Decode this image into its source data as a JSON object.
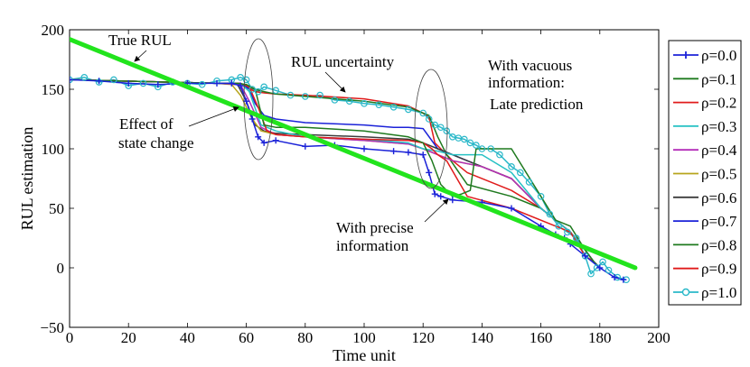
{
  "chart_data": {
    "type": "line",
    "title": "",
    "xlabel": "Time unit",
    "ylabel": "RUL estimation",
    "xlim": [
      0,
      200
    ],
    "ylim": [
      -50,
      200
    ],
    "xticks": [
      "0",
      "20",
      "40",
      "60",
      "80",
      "100",
      "120",
      "140",
      "160",
      "180",
      "200"
    ],
    "yticks": [
      "200",
      "150",
      "100",
      "50",
      "0",
      "−50"
    ],
    "grid": false,
    "legend_position": "right",
    "colors": {
      "true_rul": "#22e41d",
      "rho_0.0": "#1b22d8",
      "rho_0.1": "#1f7a1f",
      "rho_0.2": "#e01b1b",
      "rho_0.3": "#26c1c4",
      "rho_0.4": "#b32cb8",
      "rho_0.5": "#b7a51c",
      "rho_0.6": "#3d3d3d",
      "rho_0.7": "#1b22d8",
      "rho_0.8": "#1f7a1f",
      "rho_0.9": "#e01b1b",
      "rho_1.0": "#2ab8c9"
    },
    "true_rul": {
      "x": [
        0,
        192
      ],
      "y": [
        192,
        0
      ]
    },
    "legend": [
      "ρ=0.0",
      "ρ=0.1",
      "ρ=0.2",
      "ρ=0.3",
      "ρ=0.4",
      "ρ=0.5",
      "ρ=0.6",
      "ρ=0.7",
      "ρ=0.8",
      "ρ=0.9",
      "ρ=1.0"
    ],
    "series": [
      {
        "name": "ρ=0.0",
        "x": [
          0,
          10,
          20,
          30,
          40,
          50,
          55,
          58,
          60,
          62,
          64,
          66,
          70,
          80,
          90,
          100,
          110,
          115,
          120,
          122,
          124,
          126,
          130,
          140,
          150,
          160,
          165,
          168,
          170,
          175,
          180,
          185,
          188
        ],
        "y": [
          158,
          157,
          155,
          154,
          155,
          155,
          155,
          153,
          140,
          125,
          110,
          105,
          107,
          102,
          103,
          100,
          98,
          97,
          95,
          80,
          62,
          60,
          57,
          55,
          50,
          35,
          28,
          25,
          20,
          10,
          0,
          -8,
          -10
        ]
      },
      {
        "name": "ρ=0.1",
        "x": [
          0,
          50,
          57,
          60,
          63,
          66,
          70,
          80,
          100,
          115,
          120,
          123,
          126,
          128,
          130,
          133,
          136,
          138,
          140,
          150,
          160,
          165,
          170,
          175,
          178,
          180
        ],
        "y": [
          158,
          155,
          155,
          154,
          150,
          120,
          118,
          118,
          115,
          110,
          105,
          90,
          70,
          65,
          60,
          62,
          65,
          100,
          100,
          100,
          60,
          40,
          35,
          15,
          5,
          0
        ]
      },
      {
        "name": "ρ=0.2",
        "x": [
          0,
          50,
          58,
          61,
          64,
          67,
          70,
          80,
          100,
          115,
          120,
          123,
          125,
          128,
          135,
          150,
          165,
          170,
          175,
          178,
          180
        ],
        "y": [
          158,
          155,
          155,
          152,
          135,
          115,
          112,
          110,
          108,
          107,
          105,
          100,
          95,
          90,
          60,
          50,
          35,
          30,
          10,
          5,
          0
        ]
      },
      {
        "name": "ρ=0.3",
        "x": [
          0,
          50,
          58,
          61,
          65,
          70,
          80,
          100,
          115,
          120,
          125,
          130,
          140,
          150,
          160,
          165,
          170,
          175,
          178,
          180
        ],
        "y": [
          158,
          155,
          155,
          148,
          120,
          115,
          110,
          108,
          105,
          100,
          98,
          95,
          95,
          80,
          50,
          40,
          30,
          15,
          5,
          0
        ]
      },
      {
        "name": "ρ=0.4",
        "x": [
          0,
          50,
          58,
          61,
          65,
          70,
          80,
          100,
          115,
          120,
          125,
          130,
          140,
          150,
          160,
          165,
          170,
          175,
          178,
          180
        ],
        "y": [
          158,
          155,
          154,
          140,
          118,
          112,
          110,
          107,
          104,
          100,
          95,
          90,
          85,
          75,
          50,
          40,
          30,
          15,
          5,
          0
        ]
      },
      {
        "name": "ρ=0.5",
        "x": [
          0,
          50,
          55,
          58,
          62,
          65,
          70,
          80,
          100,
          115,
          120,
          125,
          130,
          140,
          150,
          160,
          165,
          170,
          175,
          178,
          180
        ],
        "y": [
          158,
          155,
          154,
          145,
          125,
          115,
          112,
          110,
          107,
          104,
          100,
          95,
          90,
          85,
          75,
          50,
          40,
          30,
          15,
          5,
          0
        ]
      },
      {
        "name": "ρ=0.6",
        "x": [
          0,
          50,
          57,
          60,
          63,
          66,
          70,
          80,
          100,
          115,
          120,
          125,
          130,
          140,
          150,
          160,
          165,
          170,
          175,
          178,
          180
        ],
        "y": [
          158,
          155,
          154,
          140,
          120,
          115,
          113,
          112,
          110,
          108,
          105,
          100,
          95,
          85,
          75,
          50,
          40,
          30,
          15,
          5,
          0
        ]
      },
      {
        "name": "ρ=0.7",
        "x": [
          0,
          50,
          58,
          61,
          63,
          66,
          70,
          80,
          100,
          110,
          115,
          120,
          125,
          130,
          140,
          150,
          160,
          165,
          170,
          175,
          178,
          180
        ],
        "y": [
          158,
          155,
          155,
          150,
          138,
          128,
          125,
          122,
          120,
          118,
          118,
          117,
          100,
          95,
          85,
          75,
          50,
          40,
          30,
          15,
          5,
          0
        ]
      },
      {
        "name": "ρ=0.8",
        "x": [
          0,
          50,
          57,
          60,
          63,
          66,
          70,
          80,
          100,
          115,
          120,
          122,
          125,
          128,
          135,
          150,
          160,
          165,
          170,
          175,
          178,
          180
        ],
        "y": [
          158,
          155,
          155,
          153,
          150,
          148,
          146,
          144,
          140,
          135,
          130,
          128,
          110,
          95,
          70,
          60,
          50,
          40,
          30,
          15,
          5,
          0
        ]
      },
      {
        "name": "ρ=0.9",
        "x": [
          0,
          50,
          58,
          60,
          63,
          66,
          70,
          80,
          100,
          115,
          120,
          122,
          124,
          126,
          130,
          135,
          150,
          160,
          165,
          170,
          175,
          178,
          180
        ],
        "y": [
          158,
          155,
          155,
          152,
          148,
          147,
          146,
          145,
          142,
          136,
          130,
          127,
          105,
          100,
          90,
          80,
          65,
          50,
          40,
          30,
          15,
          5,
          0
        ]
      },
      {
        "name": "ρ=1.0",
        "x": [
          0,
          5,
          10,
          15,
          20,
          25,
          30,
          35,
          40,
          45,
          50,
          55,
          58,
          60,
          62,
          64,
          66,
          70,
          75,
          80,
          85,
          90,
          95,
          100,
          105,
          110,
          115,
          120,
          122,
          124,
          126,
          128,
          130,
          132,
          134,
          136,
          138,
          140,
          143,
          146,
          150,
          153,
          156,
          160,
          163,
          166,
          169,
          172,
          175,
          177,
          179,
          181,
          183,
          186,
          189
        ],
        "y": [
          158,
          160,
          156,
          158,
          153,
          155,
          152,
          156,
          155,
          154,
          157,
          158,
          160,
          158,
          150,
          148,
          152,
          149,
          145,
          144,
          145,
          141,
          140,
          138,
          137,
          135,
          133,
          130,
          125,
          120,
          118,
          115,
          110,
          109,
          108,
          105,
          103,
          100,
          100,
          95,
          85,
          80,
          72,
          60,
          45,
          35,
          30,
          25,
          10,
          -5,
          0,
          5,
          -2,
          -8,
          -10
        ]
      }
    ],
    "annotations": [
      {
        "text": "True RUL"
      },
      {
        "text": "RUL uncertainty"
      },
      {
        "text": "With vacuous"
      },
      {
        "text": "information:"
      },
      {
        "text": "Late prediction"
      },
      {
        "text": "Effect of"
      },
      {
        "text": "state change"
      },
      {
        "text": "With precise"
      },
      {
        "text": "information"
      }
    ]
  }
}
